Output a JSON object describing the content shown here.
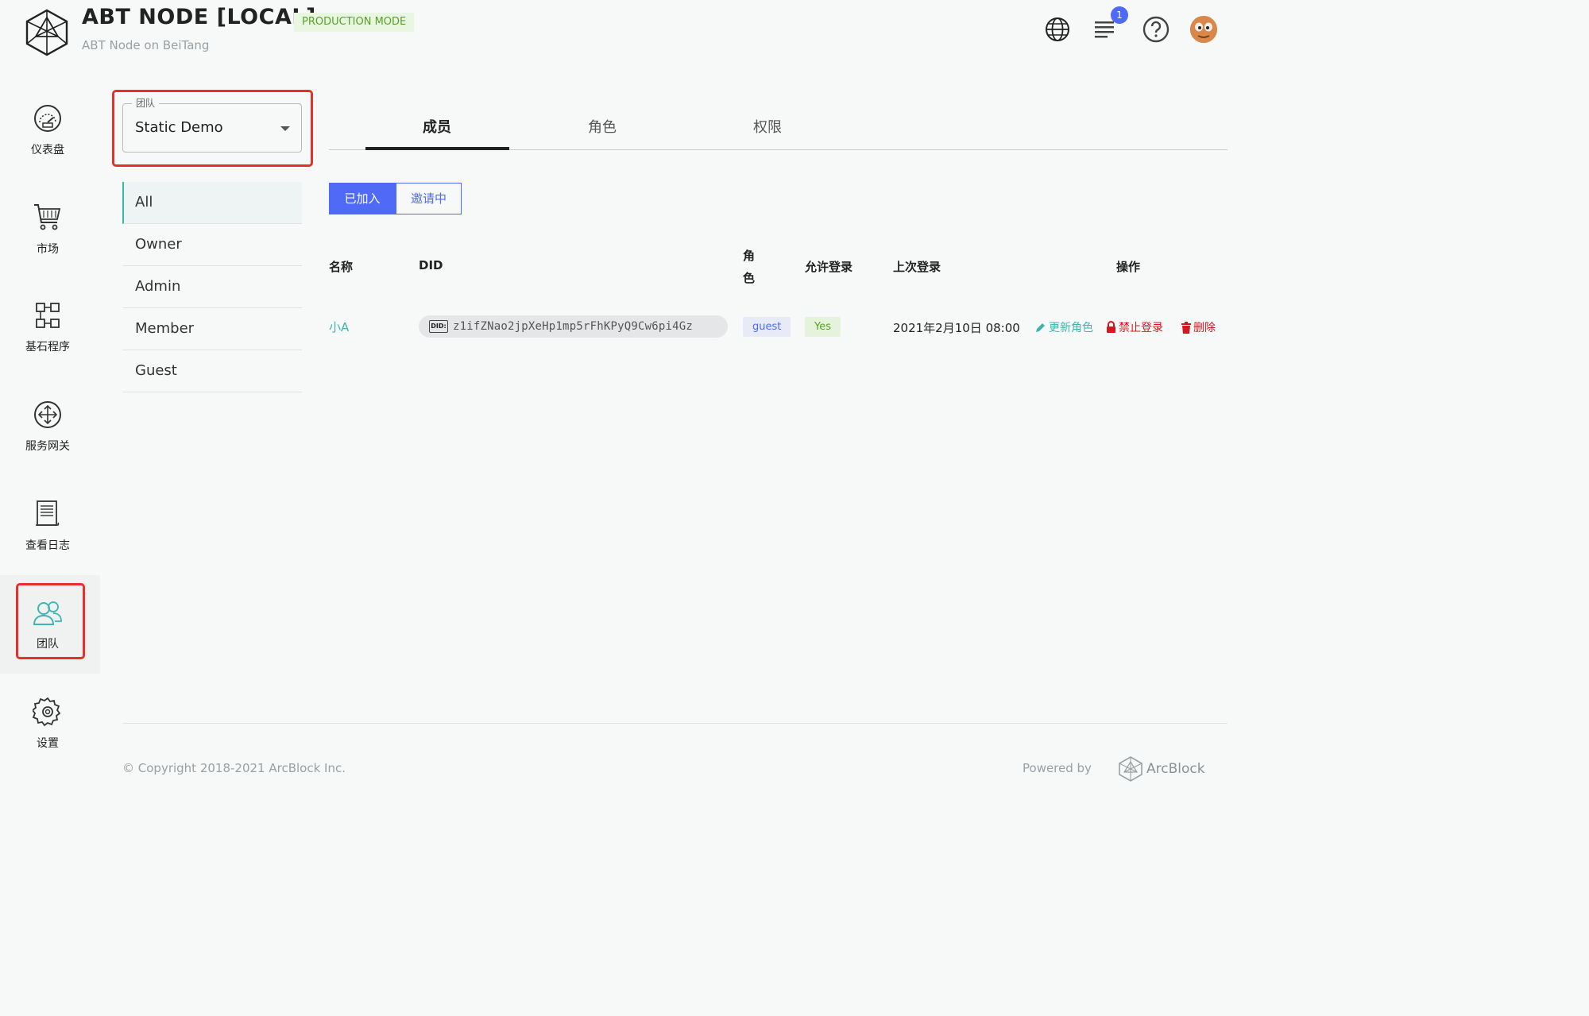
{
  "header": {
    "title": "ABT NODE [LOCAL]",
    "mode": "PRODUCTION MODE",
    "subtitle": "ABT Node on BeiTang",
    "notification_count": "1"
  },
  "sidebar": {
    "items": [
      {
        "label": "仪表盘",
        "icon": "dashboard-gauge-icon"
      },
      {
        "label": "市场",
        "icon": "cart-icon"
      },
      {
        "label": "基石程序",
        "icon": "blocklet-grid-icon"
      },
      {
        "label": "服务网关",
        "icon": "gateway-icon"
      },
      {
        "label": "查看日志",
        "icon": "log-icon"
      },
      {
        "label": "团队",
        "icon": "team-icon",
        "active": true
      },
      {
        "label": "设置",
        "icon": "gear-icon"
      }
    ]
  },
  "team_select": {
    "legend": "团队",
    "value": "Static Demo"
  },
  "role_filter": {
    "items": [
      "All",
      "Owner",
      "Admin",
      "Member",
      "Guest"
    ],
    "active": "All"
  },
  "tabs": {
    "members": "成员",
    "roles": "角色",
    "permissions": "权限",
    "active": "成员"
  },
  "segment": {
    "joined": "已加入",
    "inviting": "邀请中",
    "active": "已加入"
  },
  "table": {
    "headers": {
      "name": "名称",
      "did": "DID",
      "role_line1": "角",
      "role_line2": "色",
      "allow_login": "允许登录",
      "last_login": "上次登录",
      "actions": "操作"
    },
    "rows": [
      {
        "name": "小A",
        "did_badge": "DID:",
        "did": "z1ifZNao2jpXeHp1mp5rFhKPyQ9Cw6pi4Gz",
        "role": "guest",
        "allow_login": "Yes",
        "last_login": "2021年2月10日 08:00",
        "actions": {
          "update_role": "更新角色",
          "block_login": "禁止登录",
          "delete": "删除"
        }
      }
    ]
  },
  "footer": {
    "copyright": "© Copyright 2018-2021  ArcBlock Inc.",
    "powered_by": "Powered by",
    "brand": "ArcBlock"
  },
  "colors": {
    "accent": "#4e6af6",
    "teal": "#3eb6b0",
    "danger": "#e8302a",
    "success": "#56a228"
  }
}
